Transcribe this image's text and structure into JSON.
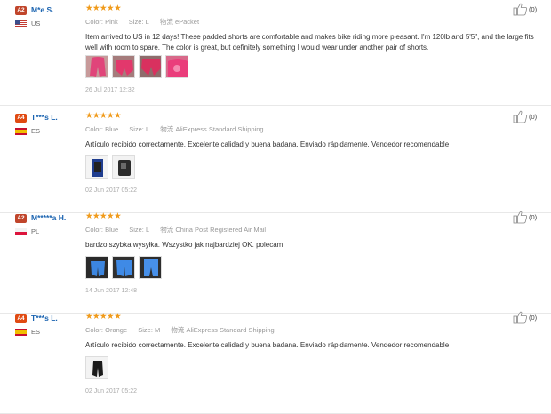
{
  "labels": {
    "color": "Color:",
    "size": "Size:",
    "shipping_icon": "物流"
  },
  "reviews": [
    {
      "badge": "A2",
      "badge_class": "a2",
      "user": "M*e S.",
      "country": "US",
      "flag": "us",
      "stars": "★★★★★",
      "color": "Pink",
      "size": "L",
      "shipping": "ePacket",
      "text": "Item arrived to US in 12 days! These padded shorts are comfortable and makes bike riding more pleasant. I'm 120lb and 5'5\", and the large fits well with room to spare. The color is great, but definitely something I would wear under another pair of shorts.",
      "photos": [
        "pink-1",
        "pink-2",
        "pink-3",
        "pink-4"
      ],
      "date": "26 Jul 2017 12:32",
      "helpful": "(0)"
    },
    {
      "badge": "A4",
      "badge_class": "a4",
      "user": "T***s L.",
      "country": "ES",
      "flag": "es",
      "stars": "★★★★★",
      "color": "Blue",
      "size": "L",
      "shipping": "AliExpress Standard Shipping",
      "text": "Artículo recibido correctamente. Excelente calidad y buena badana. Enviado rápidamente. Vendedor recomendable",
      "photos": [
        "blue-flat",
        "dark-bag"
      ],
      "date": "02 Jun 2017 05:22",
      "helpful": "(0)"
    },
    {
      "badge": "A2",
      "badge_class": "a2",
      "user": "M*****a H.",
      "country": "PL",
      "flag": "pl",
      "stars": "★★★★★",
      "color": "Blue",
      "size": "L",
      "shipping": "China Post Registered Air Mail",
      "text": "bardzo szybka wysyłka. Wszystko jak najbardziej OK. polecam",
      "photos": [
        "blue-1",
        "blue-2",
        "blue-3"
      ],
      "date": "14 Jun 2017 12:48",
      "helpful": "(0)"
    },
    {
      "badge": "A4",
      "badge_class": "a4",
      "user": "T***s L.",
      "country": "ES",
      "flag": "es",
      "stars": "★★★★★",
      "color": "Orange",
      "size": "M",
      "shipping": "AliExpress Standard Shipping",
      "text": "Artículo recibido correctamente. Excelente calidad y buena badana. Enviado rápidamente. Vendedor recomendable",
      "photos": [
        "orange-black"
      ],
      "date": "02 Jun 2017 05:22",
      "helpful": "(0)"
    }
  ],
  "colors": {
    "star": "#f09a1a",
    "username": "#1a63b0",
    "badge_a2": "#c0452b",
    "badge_a4": "#e04a12"
  }
}
